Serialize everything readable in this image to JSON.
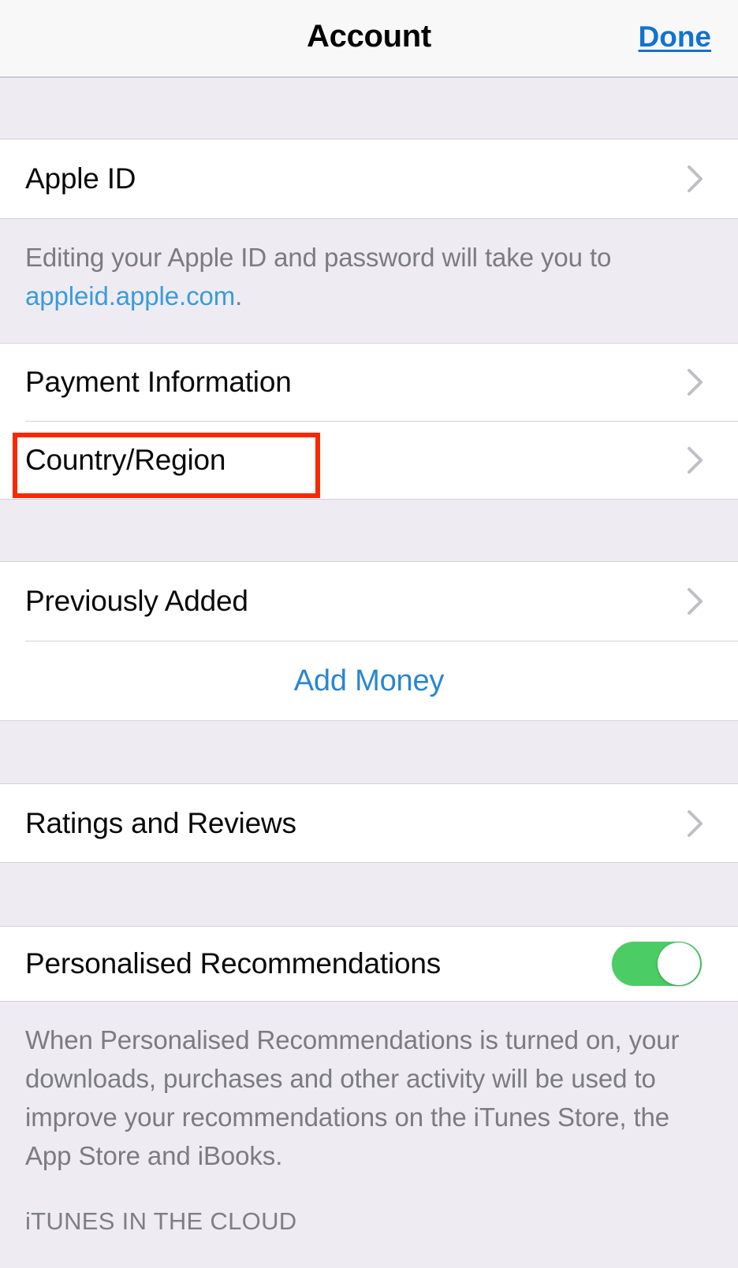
{
  "navbar": {
    "title": "Account",
    "done_label": "Done"
  },
  "sections": {
    "apple_id": {
      "row_label": "Apple ID",
      "footnote_prefix": "Editing your Apple ID and password will take you to ",
      "footnote_link": "appleid.apple.com",
      "footnote_suffix": "."
    },
    "payment": {
      "payment_information_label": "Payment Information",
      "country_region_label": "Country/Region"
    },
    "money": {
      "previously_added_label": "Previously Added",
      "add_money_label": "Add Money"
    },
    "ratings": {
      "ratings_and_reviews_label": "Ratings and Reviews"
    },
    "recommendations": {
      "row_label": "Personalised Recommendations",
      "toggle_state": "on",
      "footnote": "When Personalised Recommendations is turned on, your downloads, purchases and other activity will be used to improve your recommendations on the iTunes Store, the App Store and iBooks."
    },
    "itunes_cloud": {
      "header_label": "iTUNES IN THE CLOUD"
    }
  },
  "icons": {
    "chevron": "chevron-right-icon"
  },
  "colors": {
    "accent_blue": "#2a86cf",
    "link_blue": "#3b9bdb",
    "done_blue": "#1273cf",
    "toggle_green": "#4ccc64",
    "annotation_red": "#fa2800",
    "group_bg": "#eeecf2",
    "row_bg": "#ffffff"
  },
  "annotation": {
    "target": "Country/Region",
    "shape": "rectangle",
    "color": "#fa2800"
  }
}
